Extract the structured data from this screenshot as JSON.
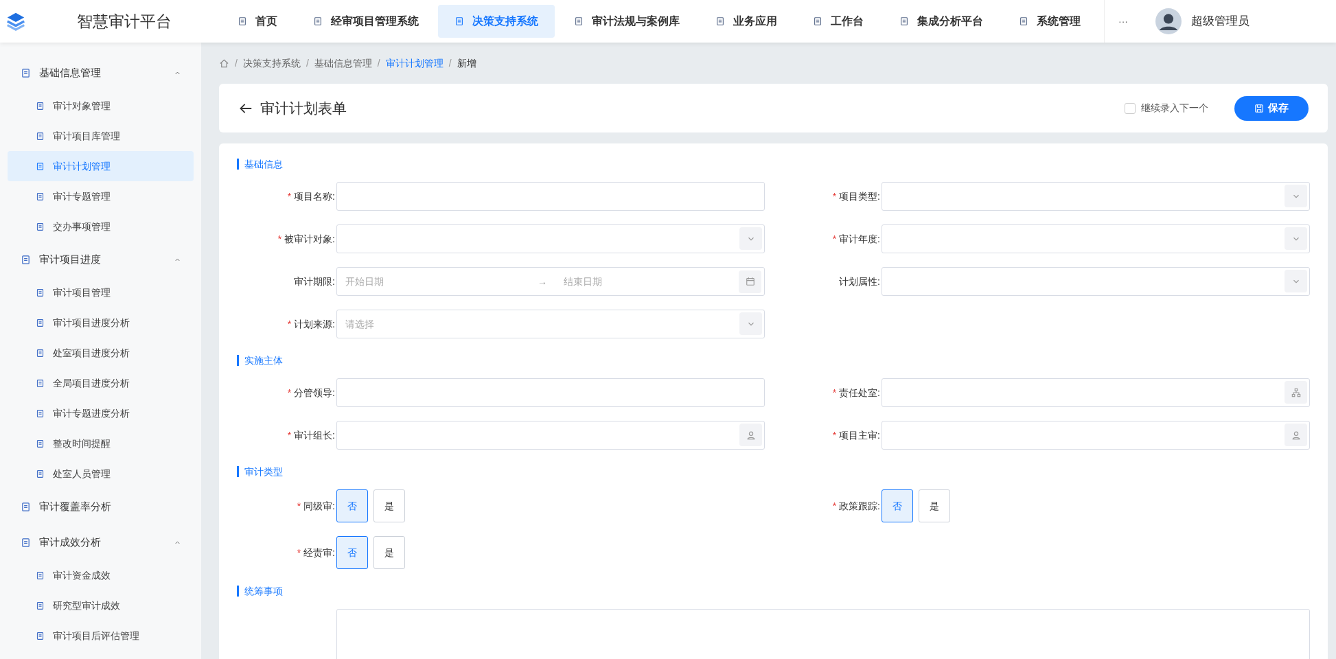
{
  "app": {
    "title": "智慧审计平台"
  },
  "nav": [
    {
      "label": "首页",
      "selected": false
    },
    {
      "label": "经审项目管理系统",
      "selected": false
    },
    {
      "label": "决策支持系统",
      "selected": true
    },
    {
      "label": "审计法规与案例库",
      "selected": false
    },
    {
      "label": "业务应用",
      "selected": false
    },
    {
      "label": "工作台",
      "selected": false
    },
    {
      "label": "集成分析平台",
      "selected": false
    },
    {
      "label": "系统管理",
      "selected": false
    }
  ],
  "nav_more": "···",
  "user": {
    "name": "超级管理员"
  },
  "sidebar": [
    {
      "label": "基础信息管理",
      "expanded": true,
      "children": [
        {
          "label": "审计对象管理",
          "selected": false
        },
        {
          "label": "审计项目库管理",
          "selected": false
        },
        {
          "label": "审计计划管理",
          "selected": true
        },
        {
          "label": "审计专题管理",
          "selected": false
        },
        {
          "label": "交办事项管理",
          "selected": false
        }
      ]
    },
    {
      "label": "审计项目进度",
      "expanded": true,
      "children": [
        {
          "label": "审计项目管理",
          "selected": false
        },
        {
          "label": "审计项目进度分析",
          "selected": false
        },
        {
          "label": "处室项目进度分析",
          "selected": false
        },
        {
          "label": "全局项目进度分析",
          "selected": false
        },
        {
          "label": "审计专题进度分析",
          "selected": false
        },
        {
          "label": "整改时间提醒",
          "selected": false
        },
        {
          "label": "处室人员管理",
          "selected": false
        }
      ]
    },
    {
      "label": "审计覆盖率分析"
    },
    {
      "label": "审计成效分析",
      "expanded": true,
      "children": [
        {
          "label": "审计资金成效",
          "selected": false
        },
        {
          "label": "研究型审计成效",
          "selected": false
        },
        {
          "label": "审计项目后评估管理",
          "selected": false
        }
      ]
    }
  ],
  "breadcrumb_separator": "/",
  "required_mark": "*",
  "breadcrumb": [
    "决策支持系统",
    "基础信息管理",
    "审计计划管理",
    "新增"
  ],
  "header": {
    "title": "审计计划表单",
    "continue_checkbox": {
      "label": "继续录入下一个",
      "checked": false
    },
    "save_button": "保存"
  },
  "sections": [
    {
      "title": "基础信息",
      "fields": [
        {
          "kind": "text",
          "label": "项目名称:",
          "required": true
        },
        {
          "kind": "select",
          "label": "项目类型:",
          "required": true
        },
        {
          "kind": "select",
          "label": "被审计对象:",
          "required": true
        },
        {
          "kind": "select",
          "label": "审计年度:",
          "required": true
        },
        {
          "kind": "daterange",
          "label": "审计期限:",
          "required": false,
          "start_placeholder": "开始日期",
          "separator": "→",
          "end_placeholder": "结束日期"
        },
        {
          "kind": "select",
          "label": "计划属性:",
          "required": false
        },
        {
          "kind": "select",
          "label": "计划来源:",
          "required": true,
          "placeholder": "请选择"
        }
      ]
    },
    {
      "title": "实施主体",
      "fields": [
        {
          "kind": "text",
          "label": "分管领导:",
          "required": true
        },
        {
          "kind": "org",
          "label": "责任处室:",
          "required": true
        },
        {
          "kind": "user",
          "label": "审计组长:",
          "required": true
        },
        {
          "kind": "user",
          "label": "项目主审:",
          "required": true
        }
      ]
    },
    {
      "title": "审计类型",
      "fields": [
        {
          "kind": "toggle",
          "label": "同级审:",
          "required": true,
          "options": [
            {
              "label": "否",
              "selected": true
            },
            {
              "label": "是",
              "selected": false
            }
          ]
        },
        {
          "kind": "toggle",
          "label": "政策跟踪:",
          "required": true,
          "options": [
            {
              "label": "否",
              "selected": true
            },
            {
              "label": "是",
              "selected": false
            }
          ]
        },
        {
          "kind": "toggle",
          "label": "经责审:",
          "required": true,
          "options": [
            {
              "label": "否",
              "selected": true
            },
            {
              "label": "是",
              "selected": false
            }
          ]
        }
      ]
    },
    {
      "title": "统筹事项",
      "fields": [
        {
          "kind": "textarea"
        }
      ]
    }
  ]
}
